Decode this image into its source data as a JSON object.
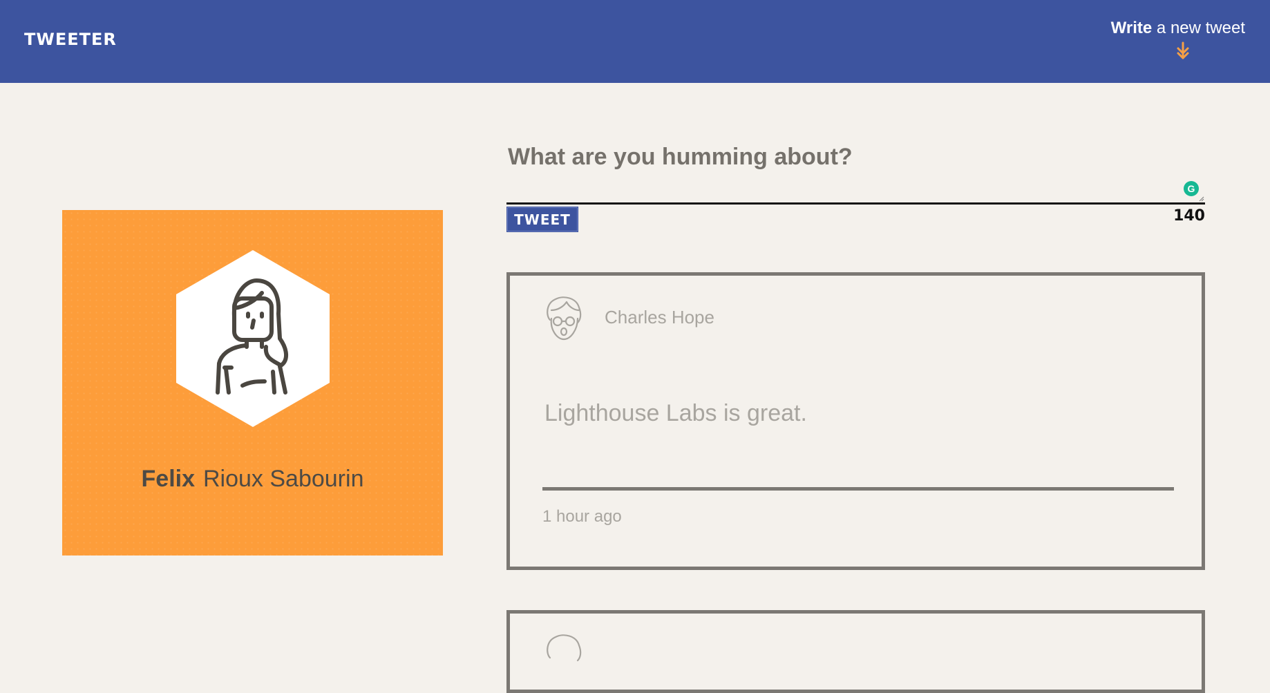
{
  "nav": {
    "brand": "TWEETER",
    "compose_bold": "Write",
    "compose_rest": "a new tweet",
    "compose_icon": "double-arrow-down-icon",
    "bg_color": "#3d549f",
    "accent_color": "#f6a046"
  },
  "profile": {
    "first_name": "Felix",
    "last_name": "Rioux Sabourin",
    "avatar_icon": "woman-avatar-icon",
    "bg_color": "#fd9d3a"
  },
  "composer": {
    "title": "What are you humming about?",
    "text_value": "",
    "submit_label": "TWEET",
    "counter": "140",
    "grammarly_icon": "G"
  },
  "tweets": [
    {
      "author": "Charles Hope",
      "avatar_icon": "man-with-glasses-avatar-icon",
      "content": "Lighthouse Labs is great.",
      "time": "1 hour ago"
    },
    {
      "author": "",
      "avatar_icon": "avatar-icon",
      "content": "",
      "time": ""
    }
  ]
}
